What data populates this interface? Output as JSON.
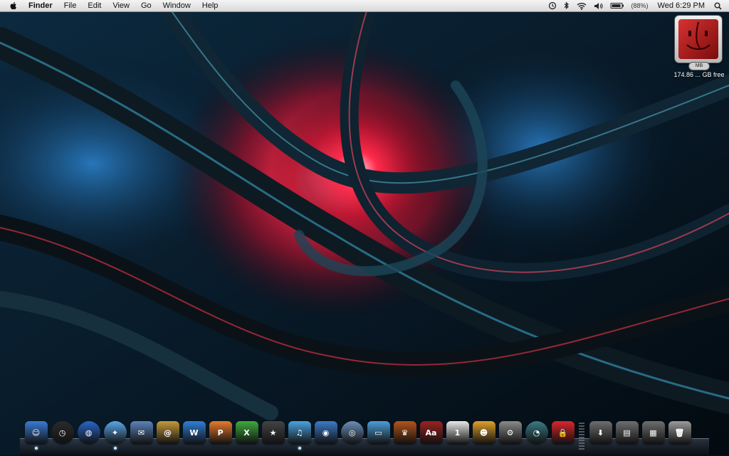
{
  "menubar": {
    "app_name": "Finder",
    "menus": [
      "File",
      "Edit",
      "View",
      "Go",
      "Window",
      "Help"
    ],
    "battery_percent": "(88%)",
    "clock": "Wed 6:29 PM"
  },
  "desktop": {
    "drive": {
      "badge": "MB",
      "free_space": "174.86 ... GB free"
    }
  },
  "dock": {
    "apps": [
      {
        "icon": "finder-icon",
        "glyph": "☺",
        "color": "#3a7bd5",
        "running": true
      },
      {
        "icon": "dashboard-icon",
        "glyph": "◷",
        "color": "#2b2b2b",
        "round": true
      },
      {
        "icon": "google-earth-icon",
        "glyph": "◍",
        "color": "#2a64c8",
        "round": true
      },
      {
        "icon": "safari-icon",
        "glyph": "✦",
        "color": "#5aa7e8",
        "round": true,
        "running": true
      },
      {
        "icon": "mail-icon",
        "glyph": "✉",
        "color": "#5b82b8"
      },
      {
        "icon": "address-book-icon",
        "glyph": "@",
        "color": "#c79a3a"
      },
      {
        "icon": "word-icon",
        "glyph": "W",
        "color": "#2f7fd6"
      },
      {
        "icon": "powerpoint-icon",
        "glyph": "P",
        "color": "#e8792f"
      },
      {
        "icon": "excel-icon",
        "glyph": "X",
        "color": "#3faa3c"
      },
      {
        "icon": "imovie-icon",
        "glyph": "★",
        "color": "#444444"
      },
      {
        "icon": "itunes-icon",
        "glyph": "♫",
        "color": "#4aa3e0",
        "running": true
      },
      {
        "icon": "iphoto-icon",
        "glyph": "◉",
        "color": "#3b7ac9"
      },
      {
        "icon": "network-icon",
        "glyph": "◎",
        "color": "#6b8fb8",
        "round": true
      },
      {
        "icon": "app-tile-icon",
        "glyph": "▭",
        "color": "#4c9ed9"
      },
      {
        "icon": "game-icon",
        "glyph": "♛",
        "color": "#b4541a"
      },
      {
        "icon": "dictionary-icon",
        "glyph": "Aa",
        "color": "#9b2222"
      },
      {
        "icon": "ical-icon",
        "glyph": "1",
        "color": "#e9e9e9"
      },
      {
        "icon": "character-icon",
        "glyph": "☻",
        "color": "#e0a12b"
      },
      {
        "icon": "system-preferences-icon",
        "glyph": "⚙",
        "color": "#8a8a8a"
      },
      {
        "icon": "time-machine-icon",
        "glyph": "◔",
        "color": "#3b7a84",
        "round": true
      },
      {
        "icon": "lock-icon",
        "glyph": "🔒",
        "color": "#d8262b"
      }
    ],
    "stacks": [
      {
        "icon": "downloads-icon",
        "glyph": "⬇",
        "color": "#6e6e6e"
      },
      {
        "icon": "documents-icon",
        "glyph": "▤",
        "color": "#6e6e6e"
      },
      {
        "icon": "pictures-icon",
        "glyph": "▦",
        "color": "#6e6e6e"
      },
      {
        "icon": "trash-icon",
        "glyph": "🗑",
        "color": "#9a9a9a"
      }
    ]
  }
}
